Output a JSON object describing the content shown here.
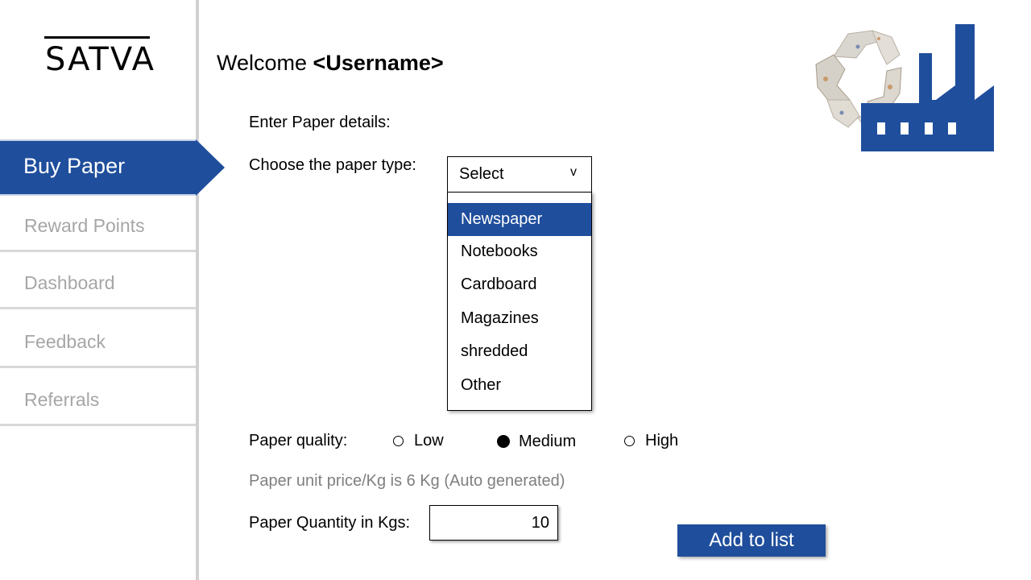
{
  "brand": {
    "logo_text": "SATVA"
  },
  "sidebar": {
    "active": "Buy Paper",
    "items": [
      "Reward Points",
      "Dashboard",
      "Feedback",
      "Referrals"
    ]
  },
  "header": {
    "welcome": "Welcome ",
    "username": "<Username>"
  },
  "form": {
    "intro": "Enter Paper details:",
    "type_label": "Choose the paper type:",
    "select_value": "Select",
    "select_chevron": "v",
    "options": [
      "Newspaper",
      "Notebooks",
      "Cardboard",
      "Magazines",
      "shredded",
      "Other"
    ],
    "highlighted_option": "Newspaper",
    "quality_label": "Paper quality:",
    "quality_options": [
      "Low",
      "Medium",
      "High"
    ],
    "quality_selected": "Medium",
    "price_text": "Paper unit price/Kg is 6 Kg (Auto generated)",
    "quantity_label": "Paper Quantity in Kgs:",
    "quantity_value": "10",
    "add_button": "Add to list"
  },
  "colors": {
    "accent": "#1f4e9c",
    "muted_text": "#a6a6a6",
    "divider": "#d0d0d0"
  },
  "icons": {
    "factory": "recycling-factory-icon"
  }
}
